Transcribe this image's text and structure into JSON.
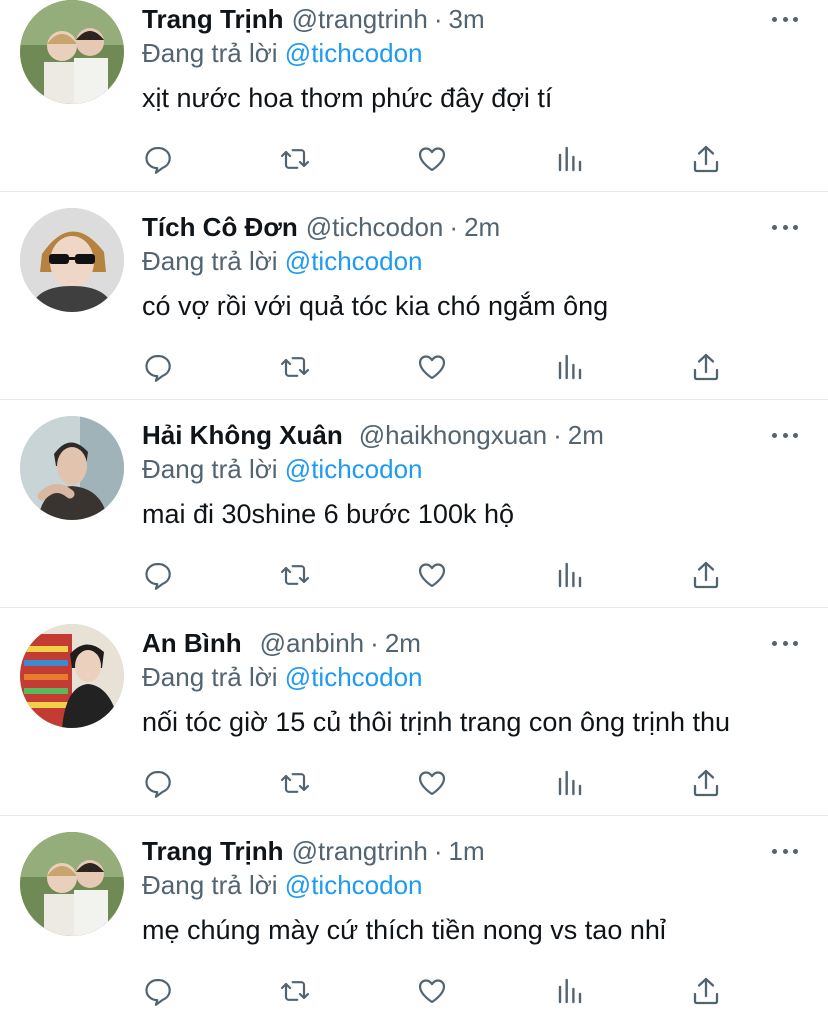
{
  "tweets": [
    {
      "name": "Trang Trịnh",
      "handle": "@trangtrinh",
      "time": "3m",
      "replying_label": "Đang trả lời",
      "replying_to": "@tichcodon",
      "text": "xịt nước hoa thơm phức đây đợi tí",
      "avatar": "avatar-photo-two-people"
    },
    {
      "name": "Tích Cô Đơn",
      "handle": "@tichcodon",
      "time": "2m",
      "replying_label": "Đang trả lời",
      "replying_to": "@tichcodon",
      "text": "có vợ rồi với quả tóc kia chó ngắm ông",
      "avatar": "avatar-photo-sunglasses"
    },
    {
      "name": "Hải Không Xuân",
      "handle": "@haikhongxuan",
      "time": "2m",
      "replying_label": "Đang trả lời",
      "replying_to": "@tichcodon",
      "text": "mai đi 30shine 6 bước 100k hộ",
      "avatar": "avatar-photo-portrait"
    },
    {
      "name": "An Bình",
      "handle": "@anbinh",
      "time": "2m",
      "replying_label": "Đang trả lời",
      "replying_to": "@tichcodon",
      "text": "nối tóc giờ 15 củ thôi trịnh trang con ông trịnh thu",
      "avatar": "avatar-photo-store"
    },
    {
      "name": "Trang Trịnh",
      "handle": "@trangtrinh",
      "time": "1m",
      "replying_label": "Đang trả lời",
      "replying_to": "@tichcodon",
      "text": "mẹ chúng mày cứ thích tiền nong vs tao nhỉ",
      "avatar": "avatar-photo-two-people"
    }
  ],
  "icons": {
    "reply": "reply-icon",
    "retweet": "retweet-icon",
    "like": "like-icon",
    "analytics": "analytics-icon",
    "share": "share-icon",
    "more": "more-icon"
  },
  "colors": {
    "name": "#0f1419",
    "secondary": "#536471",
    "mention": "#1d9bf0",
    "divider": "#e7e9ea"
  }
}
